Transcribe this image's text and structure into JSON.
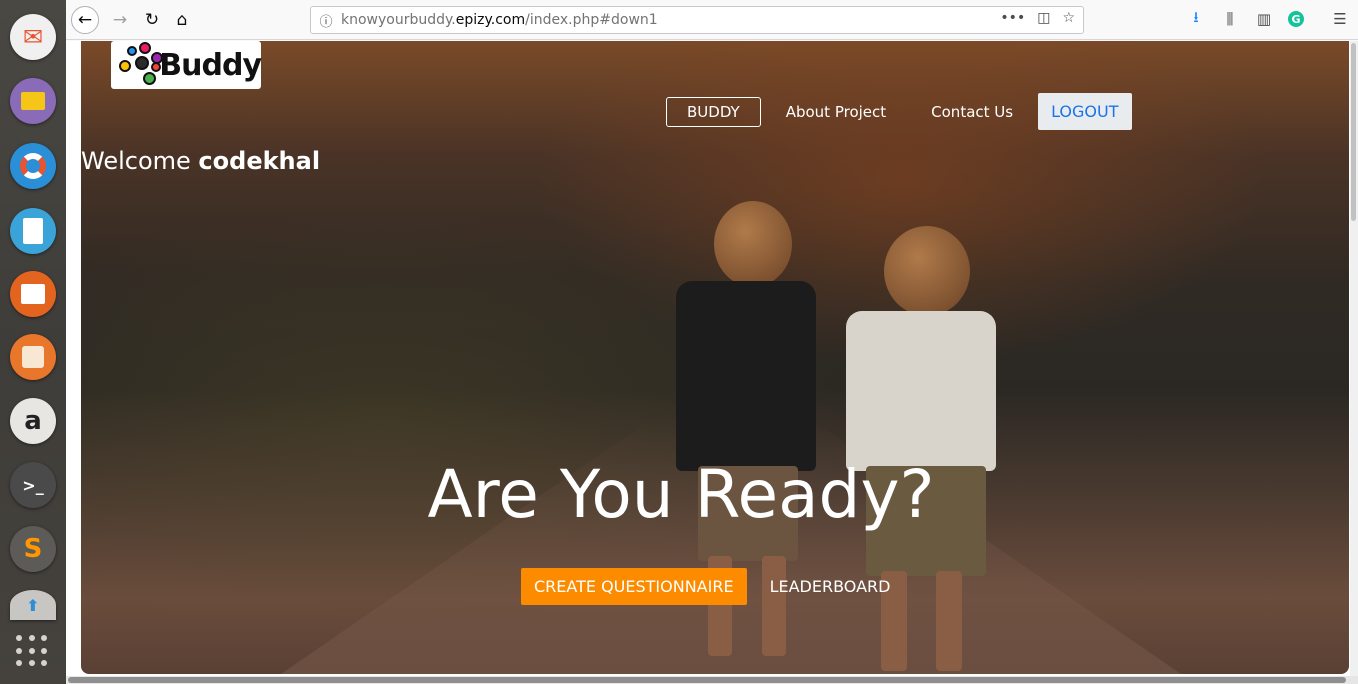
{
  "launcher": {
    "apps": [
      {
        "name": "email-client",
        "color": "#e8542f"
      },
      {
        "name": "files",
        "color": "#8a6bb8"
      },
      {
        "name": "help",
        "color": "#2a8fd6"
      },
      {
        "name": "text-editor",
        "color": "#3aa3d8"
      },
      {
        "name": "presentation",
        "color": "#e2641f"
      },
      {
        "name": "software-center",
        "color": "#e8762b"
      },
      {
        "name": "amazon",
        "color": "#d6d3cf"
      },
      {
        "name": "terminal",
        "color": "#5c5c5c"
      },
      {
        "name": "sublime-text",
        "color": "#5d5b57"
      },
      {
        "name": "updater",
        "color": "#c8c6c2"
      }
    ]
  },
  "browser": {
    "url_prefix": "knowyourbuddy.",
    "url_domain": "epizy.com",
    "url_path": "/index.php#down1"
  },
  "site": {
    "logo_text": "Buddy",
    "nav": {
      "buddy": "BUDDY",
      "about": "About Project",
      "contact": "Contact Us",
      "logout": "LOGOUT"
    },
    "welcome_prefix": "Welcome",
    "username": "codekhal",
    "headline": "Are You Ready?",
    "create_button": "CREATE QUESTIONNAIRE",
    "leaderboard_button": "LEADERBOARD"
  },
  "colors": {
    "accent_orange": "#fd8b00",
    "logout_text": "#1a73e8"
  }
}
